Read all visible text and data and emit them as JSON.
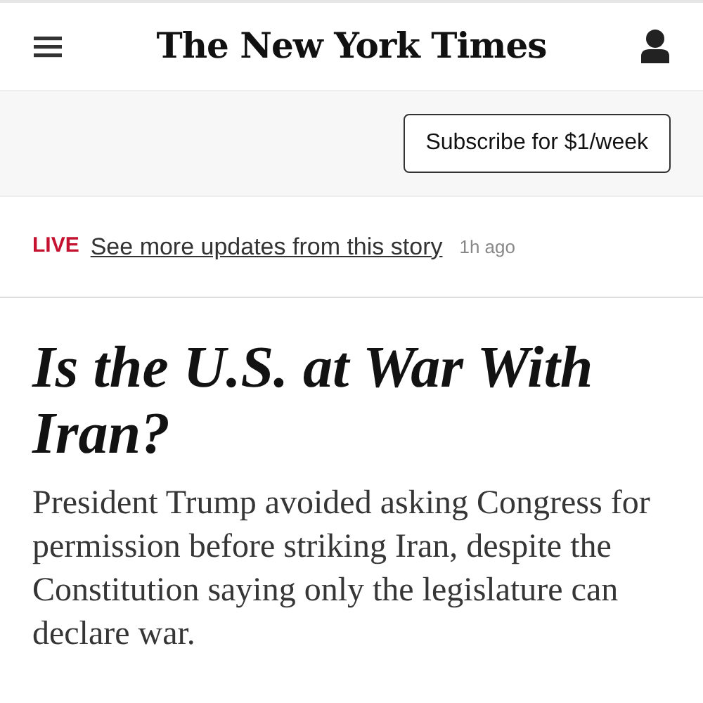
{
  "masthead": {
    "logo": "The New York Times"
  },
  "subscribe": {
    "label": "Subscribe for $1/week"
  },
  "live_bar": {
    "badge": "LIVE",
    "link": "See more updates from this story",
    "time": "1h ago"
  },
  "article": {
    "headline": "Is the U.S. at War With Iran?",
    "summary": "President Trump avoided asking Congress for permission before striking Iran, despite the Constitution saying only the legislature can declare war."
  }
}
